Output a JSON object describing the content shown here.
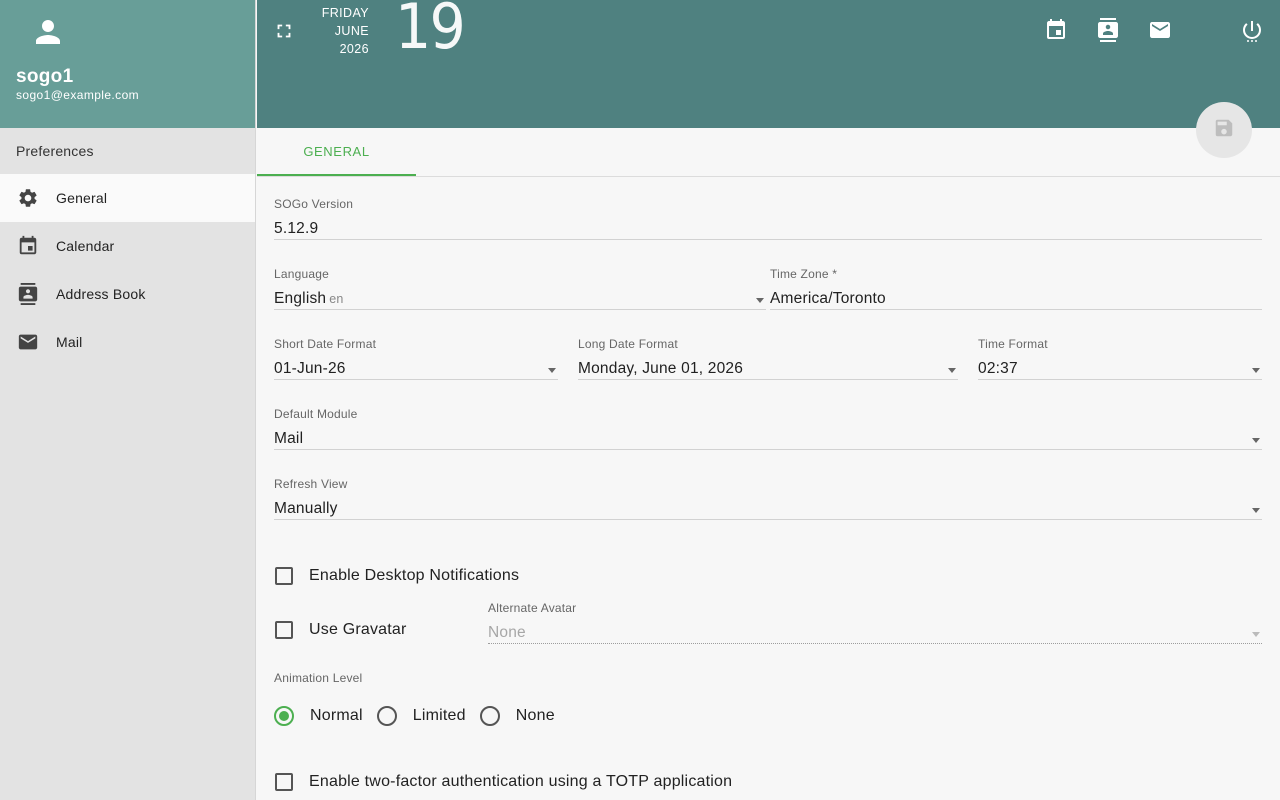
{
  "user": {
    "name": "sogo1",
    "email": "sogo1@example.com"
  },
  "sidebar": {
    "heading": "Preferences",
    "items": [
      {
        "label": "General",
        "icon": "gear-icon"
      },
      {
        "label": "Calendar",
        "icon": "calendar-icon"
      },
      {
        "label": "Address Book",
        "icon": "contacts-icon"
      },
      {
        "label": "Mail",
        "icon": "mail-icon"
      }
    ]
  },
  "topbar": {
    "weekday": "FRIDAY",
    "month": "JUNE",
    "year": "2026",
    "day": "19",
    "icons": [
      "calendar-icon",
      "contacts-icon",
      "mail-icon",
      "power-icon"
    ]
  },
  "tabs": [
    {
      "label": "GENERAL"
    }
  ],
  "form": {
    "sogo_version": {
      "label": "SOGo Version",
      "value": "5.12.9"
    },
    "language": {
      "label": "Language",
      "value": "English",
      "hint": "en"
    },
    "time_zone": {
      "label": "Time Zone *",
      "value": "America/Toronto"
    },
    "short_date": {
      "label": "Short Date Format",
      "value": "01-Jun-26"
    },
    "long_date": {
      "label": "Long Date Format",
      "value": "Monday, June 01, 2026"
    },
    "time_format": {
      "label": "Time Format",
      "value": "02:37"
    },
    "default_module": {
      "label": "Default Module",
      "value": "Mail"
    },
    "refresh_view": {
      "label": "Refresh View",
      "value": "Manually"
    },
    "desktop_notifications": {
      "label": "Enable Desktop Notifications",
      "checked": false
    },
    "gravatar": {
      "label": "Use Gravatar",
      "checked": false
    },
    "alternate_avatar": {
      "label": "Alternate Avatar",
      "value": "None"
    },
    "animation": {
      "label": "Animation Level",
      "options": [
        "Normal",
        "Limited",
        "None"
      ],
      "selected": "Normal"
    },
    "two_factor": {
      "label": "Enable two-factor authentication using a TOTP application",
      "checked": false
    }
  },
  "colors": {
    "accent": "#4caf50",
    "topbar": "#4f8180",
    "user_card": "#689e98"
  }
}
